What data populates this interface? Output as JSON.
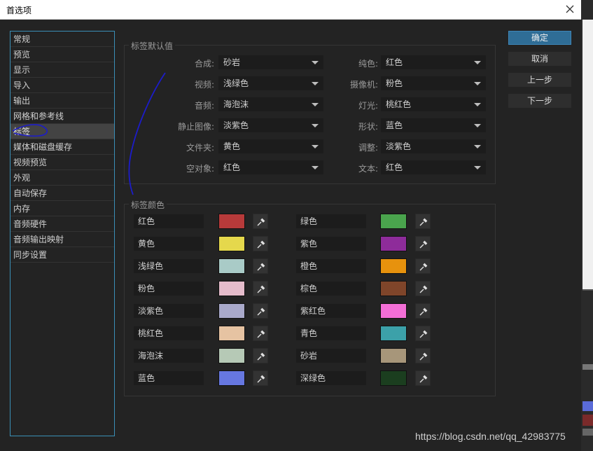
{
  "window": {
    "title": "首选项"
  },
  "sidebar": {
    "items": [
      {
        "label": "常规"
      },
      {
        "label": "预览"
      },
      {
        "label": "显示"
      },
      {
        "label": "导入"
      },
      {
        "label": "输出"
      },
      {
        "label": "网格和参考线"
      },
      {
        "label": "标签",
        "active": true
      },
      {
        "label": "媒体和磁盘缓存"
      },
      {
        "label": "视频预览"
      },
      {
        "label": "外观"
      },
      {
        "label": "自动保存"
      },
      {
        "label": "内存"
      },
      {
        "label": "音频硬件"
      },
      {
        "label": "音频输出映射"
      },
      {
        "label": "同步设置"
      }
    ]
  },
  "label_defaults": {
    "legend": "标签默认值",
    "left": [
      {
        "label": "合成:",
        "value": "砂岩"
      },
      {
        "label": "视频:",
        "value": "浅绿色"
      },
      {
        "label": "音频:",
        "value": "海泡沫"
      },
      {
        "label": "静止图像:",
        "value": "淡紫色"
      },
      {
        "label": "文件夹:",
        "value": "黄色"
      },
      {
        "label": "空对象:",
        "value": "红色"
      }
    ],
    "right": [
      {
        "label": "纯色:",
        "value": "红色"
      },
      {
        "label": "摄像机:",
        "value": "粉色"
      },
      {
        "label": "灯光:",
        "value": "桃红色"
      },
      {
        "label": "形状:",
        "value": "蓝色"
      },
      {
        "label": "调整:",
        "value": "淡紫色"
      },
      {
        "label": "文本:",
        "value": "红色"
      }
    ]
  },
  "label_colors": {
    "legend": "标签颜色",
    "left": [
      {
        "name": "红色",
        "color": "#b73a3a"
      },
      {
        "name": "黄色",
        "color": "#e5d84c"
      },
      {
        "name": "浅绿色",
        "color": "#a9cbc7"
      },
      {
        "name": "粉色",
        "color": "#e5bccb"
      },
      {
        "name": "淡紫色",
        "color": "#a9a9ca"
      },
      {
        "name": "桃红色",
        "color": "#e6c3a2"
      },
      {
        "name": "海泡沫",
        "color": "#b6c9b6"
      },
      {
        "name": "蓝色",
        "color": "#6677e0"
      }
    ],
    "right": [
      {
        "name": "绿色",
        "color": "#4aa44d"
      },
      {
        "name": "紫色",
        "color": "#8e2c9a"
      },
      {
        "name": "橙色",
        "color": "#e7920d"
      },
      {
        "name": "棕色",
        "color": "#7f452a"
      },
      {
        "name": "紫红色",
        "color": "#f36ed6"
      },
      {
        "name": "青色",
        "color": "#3ca1a9"
      },
      {
        "name": "砂岩",
        "color": "#a7967a"
      },
      {
        "name": "深绿色",
        "color": "#1b3e1f"
      }
    ]
  },
  "buttons": {
    "ok": "确定",
    "cancel": "取消",
    "previous": "上一步",
    "next": "下一步"
  },
  "watermark": "https://blog.csdn.net/qq_42983775",
  "colors": {
    "accent": "#3a8fb7",
    "primary_button": "#2f6d96",
    "background": "#232323"
  }
}
